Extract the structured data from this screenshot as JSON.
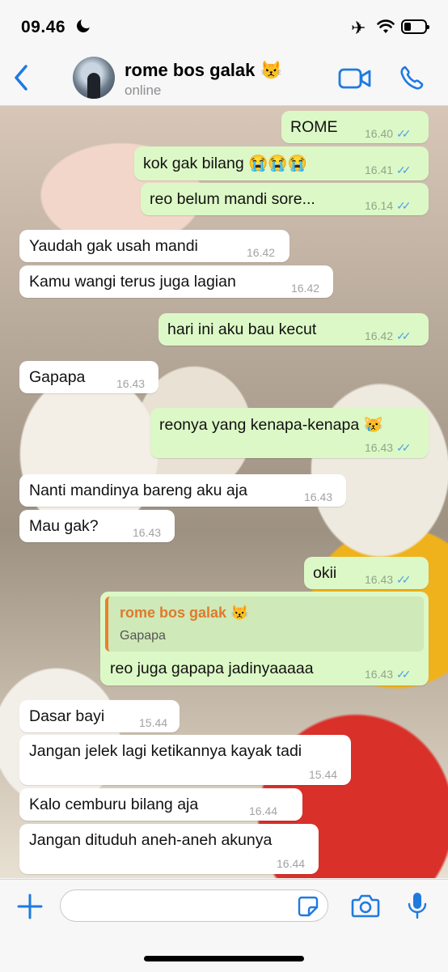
{
  "status_bar": {
    "time": "09.46"
  },
  "header": {
    "contact_name": "rome bos galak 😾",
    "contact_status": "online"
  },
  "messages": [
    {
      "dir": "out",
      "text": "ROME",
      "time": "16.40",
      "read": true
    },
    {
      "dir": "out",
      "text": "kok gak bilang 😭😭😭",
      "time": "16.41",
      "read": true
    },
    {
      "dir": "out",
      "text": "reo belum mandi sore...",
      "time": "16.14",
      "read": true
    },
    {
      "dir": "in",
      "text": "Yaudah gak usah mandi",
      "time": "16.42"
    },
    {
      "dir": "in",
      "text": "Kamu wangi terus juga lagian",
      "time": "16.42"
    },
    {
      "dir": "out",
      "text": "hari ini aku bau kecut",
      "time": "16.42",
      "read": true
    },
    {
      "dir": "in",
      "text": "Gapapa",
      "time": "16.43"
    },
    {
      "dir": "out",
      "text": "reonya yang kenapa-kenapa 😿",
      "time": "16.43",
      "read": true
    },
    {
      "dir": "in",
      "text": "Nanti mandinya bareng aku aja",
      "time": "16.43"
    },
    {
      "dir": "in",
      "text": "Mau gak?",
      "time": "16.43"
    },
    {
      "dir": "out",
      "text": "okii",
      "time": "16.43",
      "read": true
    },
    {
      "dir": "out",
      "text": "reo juga gapapa jadinyaaaaa",
      "time": "16.43",
      "read": true,
      "quote": {
        "name": "rome bos galak 😾",
        "text": "Gapapa"
      }
    },
    {
      "dir": "in",
      "text": "Dasar bayi",
      "time": "15.44"
    },
    {
      "dir": "in",
      "text": "Jangan jelek lagi ketikannya kayak tadi",
      "time": "15.44"
    },
    {
      "dir": "in",
      "text": "Kalo cemburu bilang aja",
      "time": "16.44"
    },
    {
      "dir": "in",
      "text": "Jangan dituduh aneh-aneh akunya",
      "time": "16.44"
    }
  ],
  "input": {
    "value": "",
    "placeholder": ""
  },
  "colors": {
    "accent": "#1f7ae0",
    "out_bubble": "#dcf8c6",
    "in_bubble": "#ffffff",
    "read_ticks": "#4fa3e6"
  }
}
